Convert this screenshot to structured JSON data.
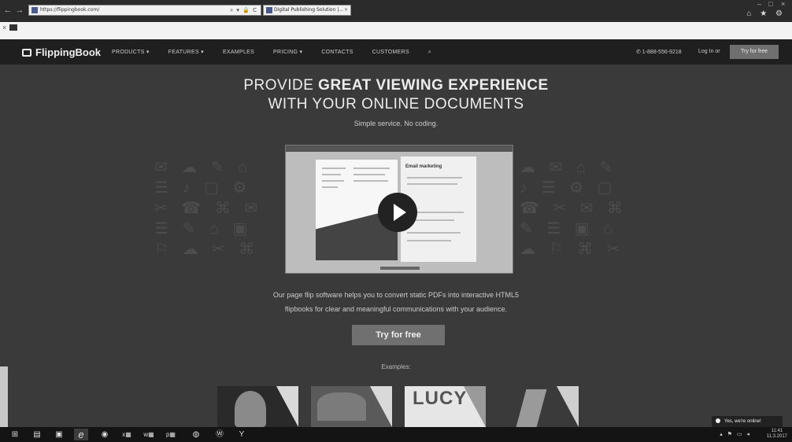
{
  "browser": {
    "address": "https://flippingbook.com/",
    "address_icons": "⌕ ▾ 🔒 C",
    "tab_title": "Digital Publishing Solution |...",
    "tab_close": "×",
    "window_controls": {
      "minimize": "–",
      "maximize": "□",
      "close": "×"
    },
    "right_icons": "⌂ ★ ⚙",
    "row2_close": "×"
  },
  "site": {
    "logo": "FlippingBook",
    "nav": [
      {
        "label": "PRODUCTS ▾"
      },
      {
        "label": "FEATURES ▾"
      },
      {
        "label": "EXAMPLES"
      },
      {
        "label": "PRICING ▾"
      },
      {
        "label": "CONTACTS"
      },
      {
        "label": "CUSTOMERS"
      },
      {
        "label": "⌕"
      }
    ],
    "phone": "✆ 1-888-556-9218",
    "login": "Log In  or",
    "try_header": "Try for free"
  },
  "hero": {
    "title_prefix": "PROVIDE ",
    "title_bold": "GREAT VIEWING EXPERIENCE",
    "title_line2": "WITH YOUR ONLINE DOCUMENTS",
    "subtitle": "Simple service. No coding.",
    "video_heading": "Email marketing",
    "description_line1": "Our page flip software helps you to convert static PDFs into interactive HTML5",
    "description_line2": "flipbooks for clear and meaningful communications with your audience.",
    "cta": "Try for free",
    "examples_label": "Examples:"
  },
  "examples": [
    {
      "name": "example-portrait"
    },
    {
      "name": "example-wisdom"
    },
    {
      "name": "example-lucy",
      "text": "LUCY"
    },
    {
      "name": "example-motorcycle"
    }
  ],
  "chat": {
    "label": "Yes, we're online!"
  },
  "taskbar": {
    "buttons": [
      {
        "icon": "windows-icon",
        "glyph": "⊞"
      },
      {
        "icon": "file-explorer-icon",
        "glyph": "▤"
      },
      {
        "icon": "store-icon",
        "glyph": "▣"
      },
      {
        "icon": "internet-explorer-icon",
        "glyph": "e"
      },
      {
        "icon": "chrome-icon",
        "glyph": "◉"
      },
      {
        "icon": "excel-icon",
        "glyph": "x▦"
      },
      {
        "icon": "word-icon",
        "glyph": "w▦"
      },
      {
        "icon": "powerpoint-icon",
        "glyph": "p▦"
      },
      {
        "icon": "app-icon",
        "glyph": "◍"
      },
      {
        "icon": "app-w-icon",
        "glyph": "Ⓦ"
      },
      {
        "icon": "app-y-icon",
        "glyph": "Y"
      }
    ],
    "tray": "▴ ⚑ ▭ ◂",
    "time": "11:41",
    "date": "11.3.2017"
  }
}
